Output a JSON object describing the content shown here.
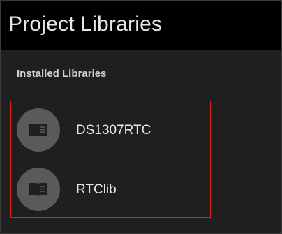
{
  "header": {
    "title": "Project Libraries"
  },
  "section": {
    "heading": "Installed Libraries"
  },
  "libraries": [
    {
      "label": "DS1307RTC",
      "icon": "book-icon"
    },
    {
      "label": "RTClib",
      "icon": "book-icon"
    }
  ],
  "colors": {
    "background": "#1f1f1f",
    "title_bar": "#000000",
    "avatar": "#5a5a5a",
    "highlight": "#e02020",
    "text": "#e8e8e8"
  }
}
